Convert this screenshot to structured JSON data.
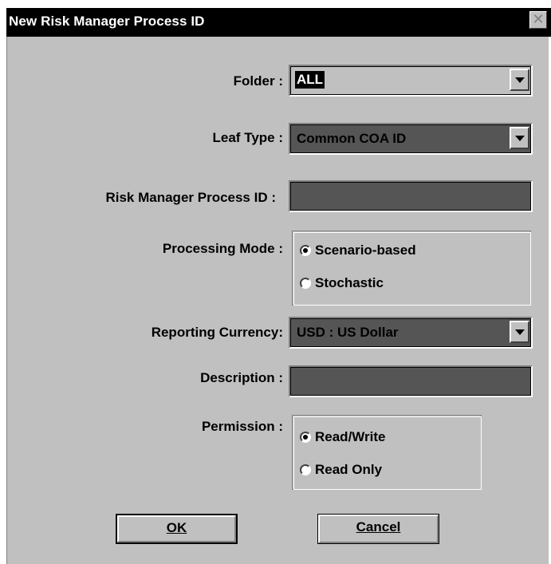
{
  "window": {
    "title": "New Risk Manager Process ID",
    "close_glyph": "✕"
  },
  "form": {
    "folder": {
      "label": "Folder :",
      "value": "ALL"
    },
    "leaf_type": {
      "label": "Leaf Type :",
      "value": "Common COA ID"
    },
    "process_id": {
      "label": "Risk Manager Process ID :",
      "value": ""
    },
    "processing_mode": {
      "label": "Processing Mode :",
      "options": [
        {
          "label": "Scenario-based",
          "selected": true
        },
        {
          "label": "Stochastic",
          "selected": false
        }
      ]
    },
    "reporting_currency": {
      "label": "Reporting Currency:",
      "value": "USD : US Dollar"
    },
    "description": {
      "label": "Description :",
      "value": ""
    },
    "permission": {
      "label": "Permission :",
      "options": [
        {
          "label": "Read/Write",
          "selected": true
        },
        {
          "label": "Read Only",
          "selected": false
        }
      ]
    }
  },
  "buttons": {
    "ok": "OK",
    "cancel": "Cancel"
  },
  "colors": {
    "title_bar": "#000000",
    "dialog_bg": "#c0c0c0",
    "field_bg": "#555555"
  }
}
